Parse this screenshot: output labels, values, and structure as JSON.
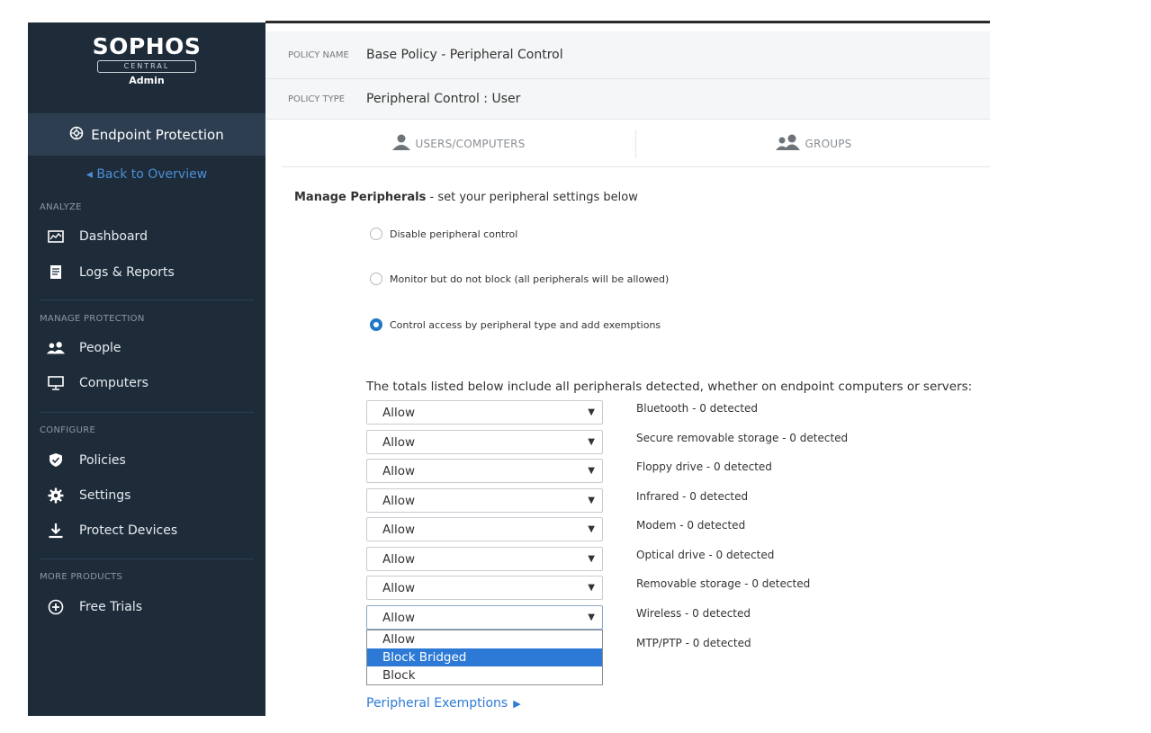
{
  "brand": {
    "name": "SOPHOS",
    "product": "CENTRAL",
    "role": "Admin"
  },
  "sidebar": {
    "section": "Endpoint Protection",
    "back": "Back to Overview",
    "categories": {
      "analyze": "ANALYZE",
      "manage": "MANAGE PROTECTION",
      "configure": "CONFIGURE",
      "more": "MORE PRODUCTS"
    },
    "items": {
      "dashboard": "Dashboard",
      "logs": "Logs & Reports",
      "people": "People",
      "computers": "Computers",
      "policies": "Policies",
      "settings": "Settings",
      "protect": "Protect Devices",
      "trials": "Free Trials"
    }
  },
  "policy": {
    "name_label": "POLICY NAME",
    "name": "Base Policy - Peripheral Control",
    "type_label": "POLICY TYPE",
    "type": "Peripheral Control : User"
  },
  "tabs": {
    "users": "USERS/COMPUTERS",
    "groups": "GROUPS"
  },
  "manage": {
    "title": "Manage Peripherals",
    "subtitle": " - set your peripheral settings below"
  },
  "radios": {
    "disable": "Disable peripheral control",
    "monitor": "Monitor but do not block (all peripherals will be allowed)",
    "control": "Control access by peripheral type and add exemptions",
    "selected": "control"
  },
  "totals_text": "The totals listed below include all peripherals detected, whether on endpoint computers or servers:",
  "peripherals": [
    {
      "value": "Allow",
      "label": "Bluetooth - 0 detected"
    },
    {
      "value": "Allow",
      "label": "Secure removable storage - 0 detected"
    },
    {
      "value": "Allow",
      "label": "Floppy drive - 0 detected"
    },
    {
      "value": "Allow",
      "label": "Infrared - 0 detected"
    },
    {
      "value": "Allow",
      "label": "Modem - 0 detected"
    },
    {
      "value": "Allow",
      "label": "Optical drive - 0 detected"
    },
    {
      "value": "Allow",
      "label": "Removable storage - 0 detected"
    },
    {
      "value": "Allow",
      "label": "Wireless - 0 detected"
    },
    {
      "label": "MTP/PTP - 0 detected"
    }
  ],
  "dropdown_options": [
    "Allow",
    "Block Bridged",
    "Block"
  ],
  "dropdown_highlighted": "Block Bridged",
  "exemptions_link": "Peripheral Exemptions",
  "colors": {
    "sidebar_bg": "#1e2c3a",
    "accent": "#2d7ad6",
    "link": "#4c8ed6"
  }
}
